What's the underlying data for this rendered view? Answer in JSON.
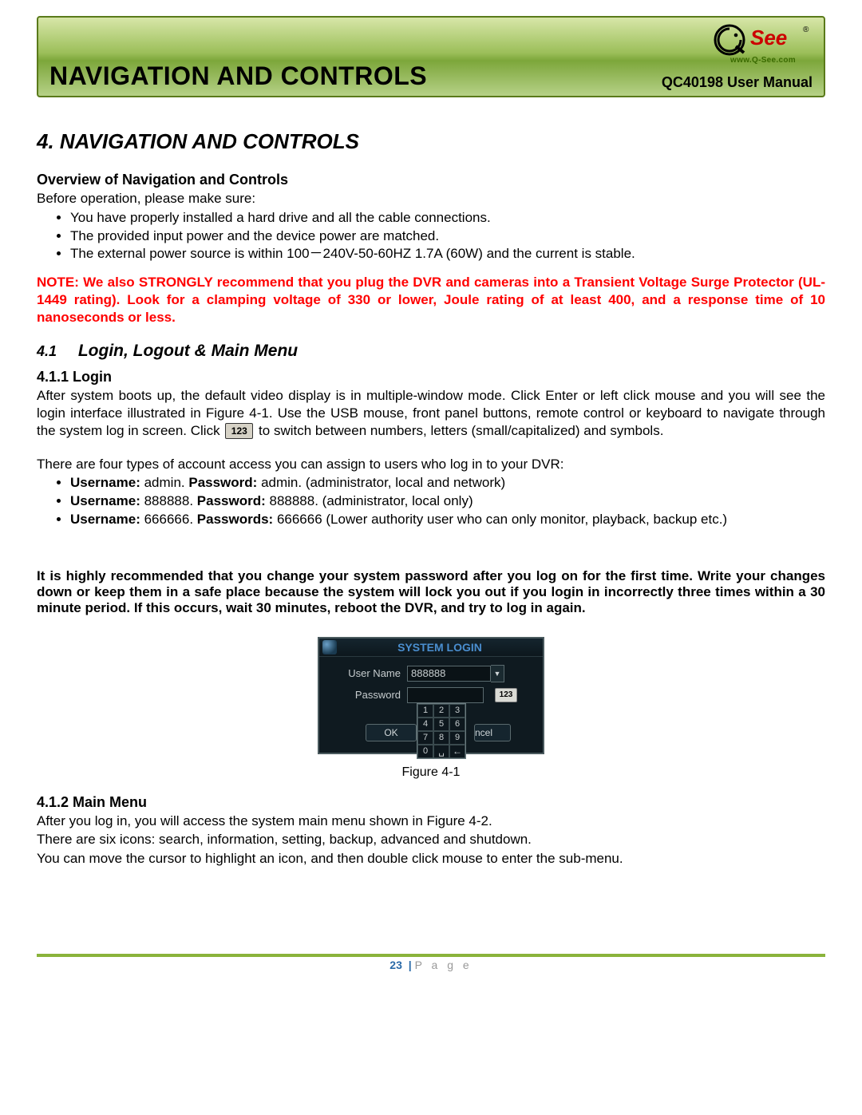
{
  "header": {
    "title": "NAVIGATION AND CONTROLS",
    "product": "QC40198 User Manual",
    "logo_text": "Q-See",
    "logo_url": "www.Q-See.com"
  },
  "chapter": {
    "title": "4. NAVIGATION AND CONTROLS"
  },
  "overview": {
    "heading": "Overview of Navigation and Controls",
    "intro": "Before operation, please make sure:",
    "bullets": [
      "You have properly installed a hard drive and all the cable connections.",
      "The provided input power and the device power are matched.",
      "The external power source is within 100－240V-50-60HZ 1.7A (60W) and the current is stable."
    ],
    "note": "NOTE: We also STRONGLY recommend that you plug the DVR and cameras into a Transient Voltage Surge Protector (UL-1449 rating). Look for a clamping voltage of 330 or lower, Joule rating of at least 400, and a response time of 10 nanoseconds or less."
  },
  "section41": {
    "num": "4.1",
    "title": "Login, Logout & Main Menu"
  },
  "login": {
    "heading": "4.1.1  Login",
    "para1a": "After system boots up, the default video display is in multiple-window mode. Click Enter or left click mouse and you will see the login interface illustrated in Figure 4-1. Use the USB mouse, front panel buttons, remote control or keyboard to navigate through the system log in screen.   Click ",
    "inline123": "123",
    "para1b": " to switch between numbers, letters (small/capitalized) and symbols.",
    "accounts_intro": "There are four types of account access you can assign to users who log in to your DVR:",
    "accounts": [
      {
        "u_label": "Username:",
        "u": " admin.  ",
        "p_label": "Password:",
        "p": " admin. (administrator, local and network)"
      },
      {
        "u_label": "Username:",
        "u": " 888888. ",
        "p_label": "Password:",
        "p": " 888888. (administrator, local only)"
      },
      {
        "u_label": "Username:",
        "u": " 666666. ",
        "p_label": "Passwords:",
        "p": " 666666 (Lower authority user who can only monitor, playback, backup etc.)"
      }
    ],
    "recommend": "It is highly recommended that you change your system password after you log on for the first time. Write your changes down or keep them in a safe place because the system will lock you out if you login in incorrectly three times within a 30 minute period. If this occurs, wait 30 minutes, reboot the DVR, and try to log in again."
  },
  "login_dialog": {
    "title": "SYSTEM LOGIN",
    "username_label": "User Name",
    "username_value": "888888",
    "password_label": "Password",
    "key123": "123",
    "ok": "OK",
    "cancel_visible": "ncel",
    "keypad": [
      "1",
      "2",
      "3",
      "4",
      "5",
      "6",
      "7",
      "8",
      "9",
      "0",
      "␣",
      "←"
    ]
  },
  "figure": {
    "caption": "Figure 4-1"
  },
  "mainmenu": {
    "heading": "4.1.2  Main Menu",
    "line1": "After you log in, you will access the system main menu shown in Figure 4-2.",
    "line2": "There are six icons: search, information, setting, backup, advanced and shutdown.",
    "line3": "You can move the cursor to highlight an icon, and then double click mouse to enter the sub-menu."
  },
  "footer": {
    "page_number": "23",
    "label": "P a g e"
  }
}
